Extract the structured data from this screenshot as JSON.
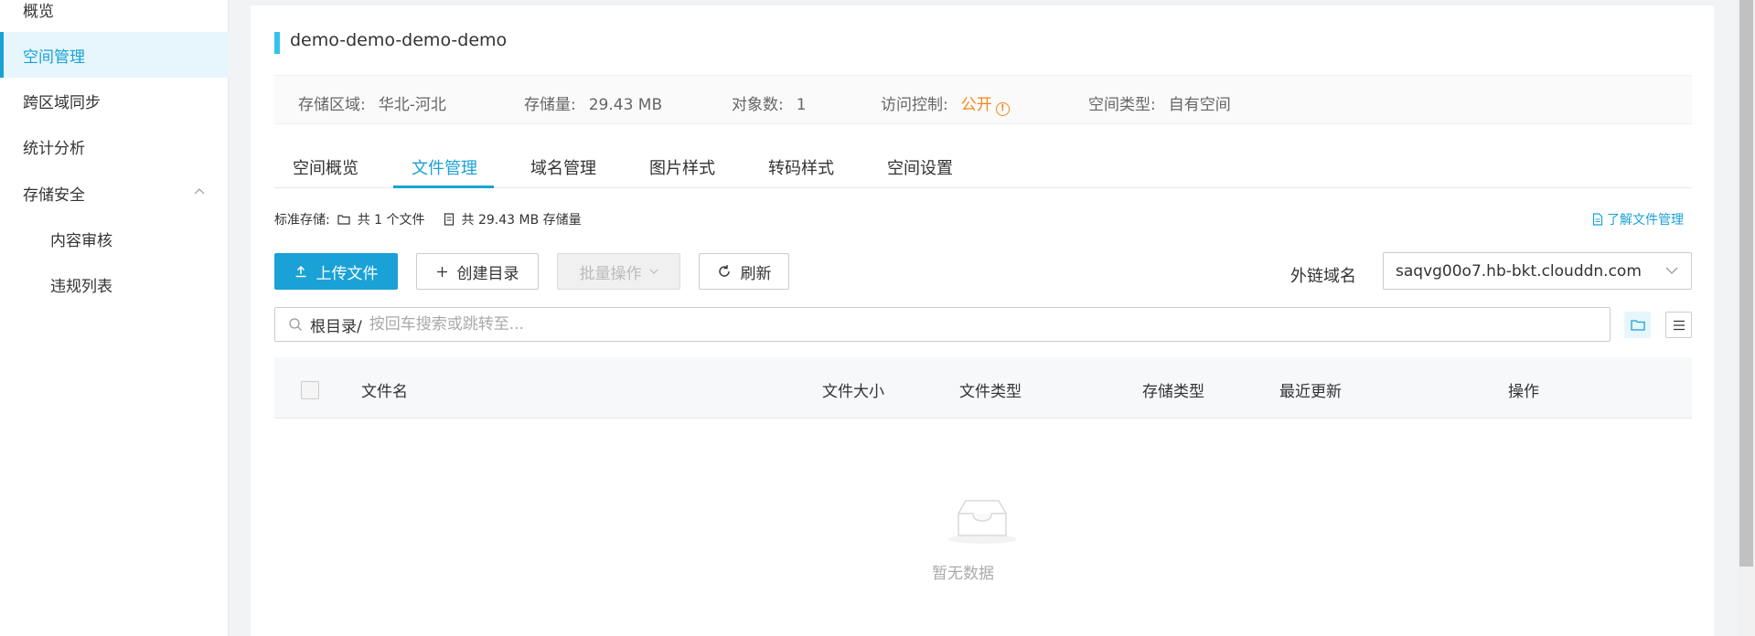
{
  "sidebar": {
    "items": [
      {
        "label": "概览"
      },
      {
        "label": "空间管理"
      },
      {
        "label": "跨区域同步"
      },
      {
        "label": "统计分析"
      },
      {
        "label": "存储安全"
      },
      {
        "label": "内容审核"
      },
      {
        "label": "违规列表"
      }
    ]
  },
  "bucket": {
    "title": "demo-demo-demo-demo",
    "info": {
      "region_label": "存储区域:",
      "region_value": "华北-河北",
      "storage_label": "存储量:",
      "storage_value": "29.43 MB",
      "objects_label": "对象数:",
      "objects_value": "1",
      "access_label": "访问控制:",
      "access_value": "公开",
      "type_label": "空间类型:",
      "type_value": "自有空间"
    }
  },
  "tabs": [
    {
      "label": "空间概览"
    },
    {
      "label": "文件管理"
    },
    {
      "label": "域名管理"
    },
    {
      "label": "图片样式"
    },
    {
      "label": "转码样式"
    },
    {
      "label": "空间设置"
    }
  ],
  "stats": {
    "prefix": "标准存储:",
    "files": "共 1 个文件",
    "size": "共 29.43 MB 存储量",
    "learn_link": "了解文件管理"
  },
  "toolbar": {
    "upload": "上传文件",
    "mkdir": "创建目录",
    "batch": "批量操作",
    "refresh": "刷新",
    "domain_label": "外链域名",
    "domain_value": "saqvg00o7.hb-bkt.clouddn.com"
  },
  "search": {
    "root": "根目录/",
    "placeholder": "按回车搜索或跳转至..."
  },
  "table": {
    "headers": [
      "文件名",
      "文件大小",
      "文件类型",
      "存储类型",
      "最近更新",
      "操作"
    ],
    "empty_text": "暂无数据"
  },
  "colors": {
    "accent": "#1aa1d6",
    "warning": "#f08a1c",
    "title_bar": "#36c2ee"
  }
}
